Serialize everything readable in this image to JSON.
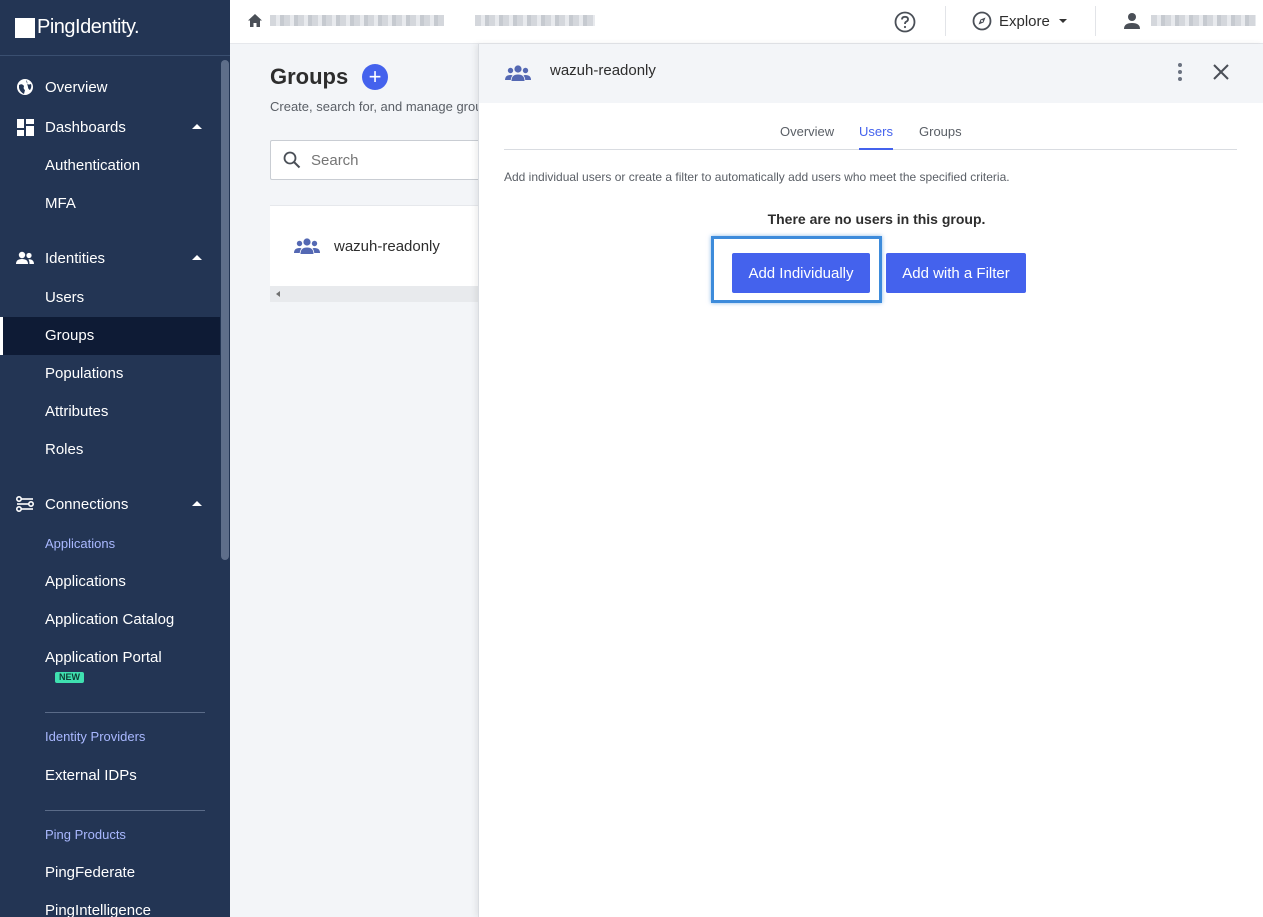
{
  "sidebar": {
    "logo": "PingIdentity.",
    "items": [
      {
        "label": "Overview"
      },
      {
        "label": "Dashboards"
      },
      {
        "label": "Authentication"
      },
      {
        "label": "MFA"
      },
      {
        "label": "Identities"
      },
      {
        "label": "Users"
      },
      {
        "label": "Groups"
      },
      {
        "label": "Populations"
      },
      {
        "label": "Attributes"
      },
      {
        "label": "Roles"
      },
      {
        "label": "Connections"
      },
      {
        "label": "Applications"
      },
      {
        "label": "Application Catalog"
      },
      {
        "label": "Application Portal"
      },
      {
        "label": "External IDPs"
      },
      {
        "label": "PingFederate"
      },
      {
        "label": "PingIntelligence"
      }
    ],
    "sections": {
      "applications": "Applications",
      "identity_providers": "Identity Providers",
      "ping_products": "Ping Products"
    },
    "badge_new": "NEW",
    "active_item": "Groups"
  },
  "topbar": {
    "explore_label": "Explore"
  },
  "groups_page": {
    "title": "Groups",
    "add_symbol": "+",
    "subtitle": "Create, search for, and manage groups",
    "search_placeholder": "Search",
    "rows": [
      {
        "name": "wazuh-readonly"
      }
    ]
  },
  "panel": {
    "title": "wazuh-readonly",
    "tabs": [
      {
        "label": "Overview"
      },
      {
        "label": "Users"
      },
      {
        "label": "Groups"
      }
    ],
    "active_tab": "Users",
    "description": "Add individual users or create a filter to automatically add users who meet the specified criteria.",
    "empty_message": "There are no users in this group.",
    "add_individually_label": "Add Individually",
    "add_filter_label": "Add with a Filter"
  },
  "colors": {
    "sidebar_bg": "#233554",
    "accent": "#4462ed",
    "highlight": "#3d8bdb",
    "new_badge": "#3fe0b0"
  }
}
